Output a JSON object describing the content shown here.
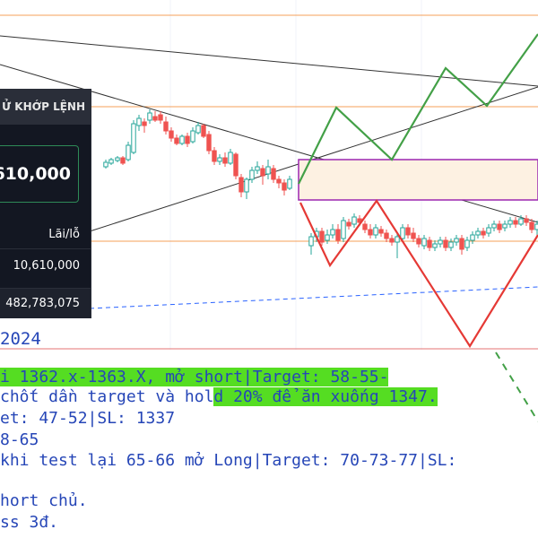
{
  "order_panel": {
    "title": "Ử KHỚP LỆNH",
    "price": ",610,000",
    "pnl_label": "Lãi/lỗ",
    "row1_value": "10,610,000",
    "row2_value": "482,783,075"
  },
  "year_label": "2024",
  "notes": [
    {
      "text": "i 1362.x-1363.X, mở short|Target: 58-55-",
      "highlight": true
    },
    {
      "text": "chốt dần target và hold 20% để ăn xuống 1347.",
      "highlight_range": [
        22,
        48
      ]
    },
    {
      "text": "et: 47-52|SL: 1337"
    },
    {
      "text": "8-65"
    },
    {
      "text": "khi test lại 65-66 mở Long|Target: 70-73-77|SL:"
    },
    {
      "text": "hort chủ."
    },
    {
      "text": "ss 3đ."
    }
  ],
  "colors": {
    "bull_candle": "#26a69a",
    "bear_candle": "#ef5350",
    "scenario_up": "#43a047",
    "scenario_down": "#e53935",
    "zone_border": "#9c27b0",
    "zone_fill": "#fdf1e2",
    "level_line": "#f5a05a",
    "trend_line": "#333333",
    "support_dashed": "#2962ff",
    "note_text": "#2646b7",
    "note_highlight": "#55dd22"
  }
}
